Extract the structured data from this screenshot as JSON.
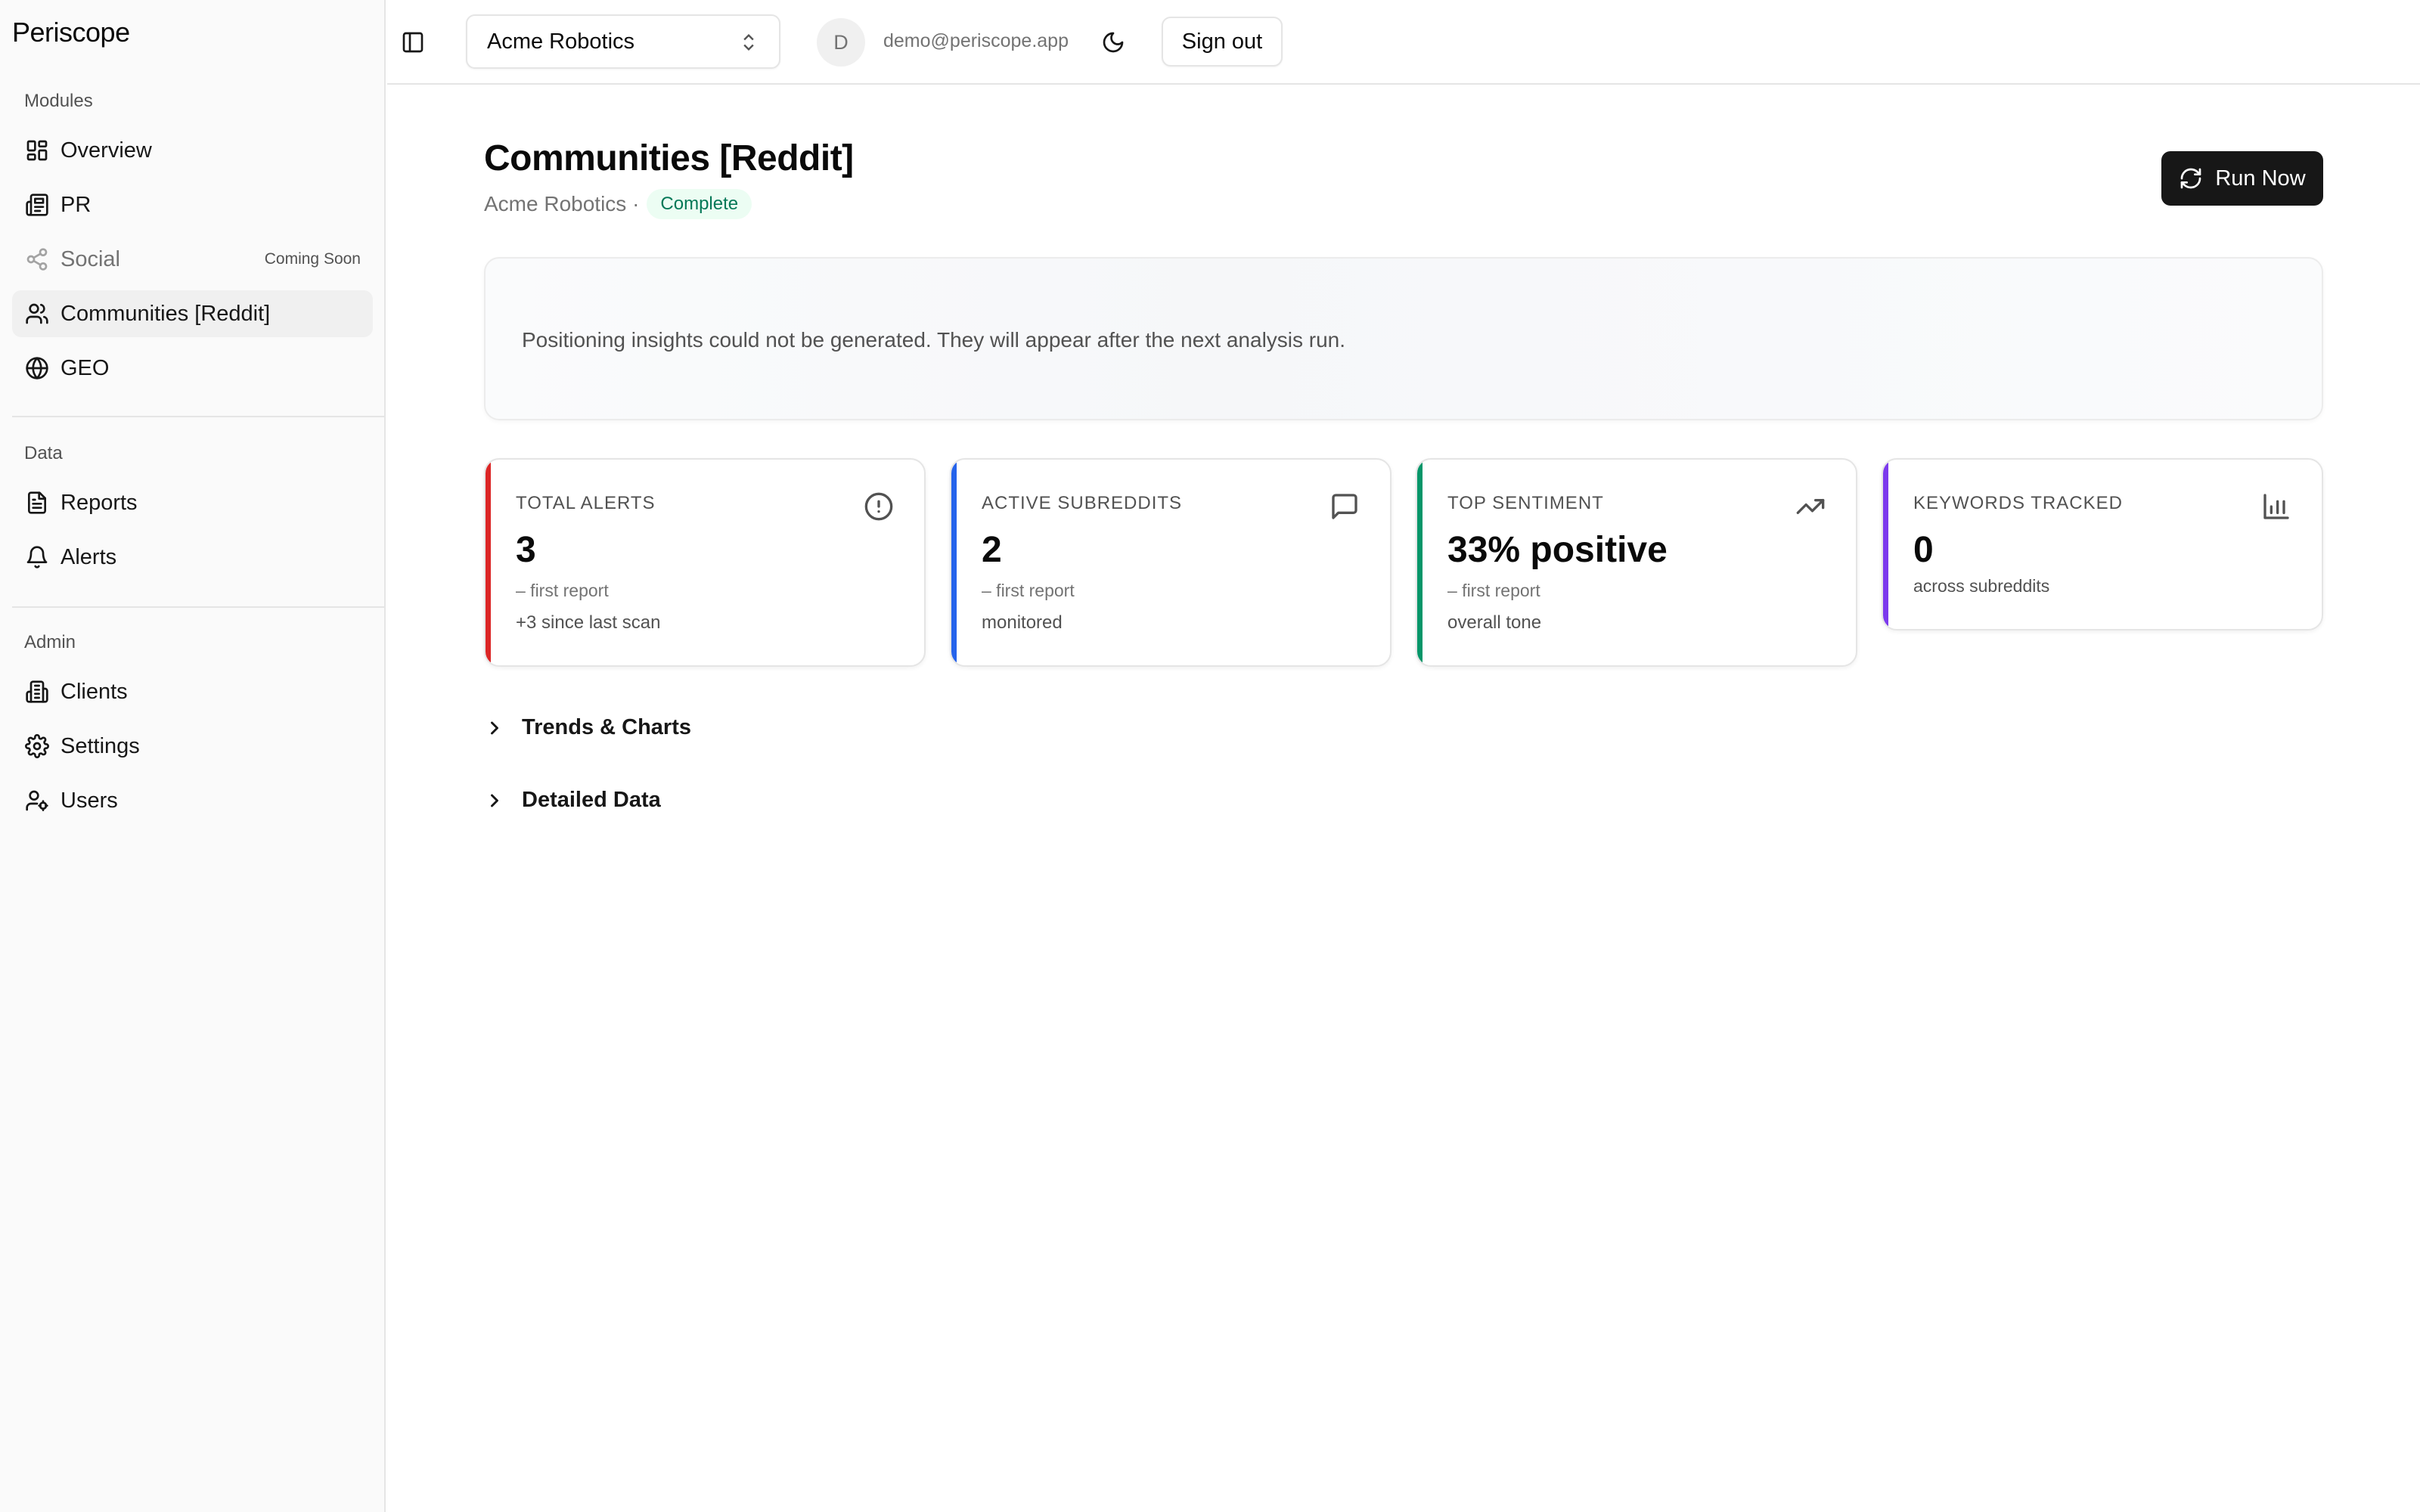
{
  "app": {
    "brand": "Periscope"
  },
  "sidebar": {
    "groups": [
      {
        "label": "Modules",
        "items": [
          {
            "label": "Overview",
            "icon": "dashboard-icon"
          },
          {
            "label": "PR",
            "icon": "newspaper-icon"
          },
          {
            "label": "Social",
            "icon": "share-icon",
            "badge": "Coming Soon",
            "disabled": true
          },
          {
            "label": "Communities [Reddit]",
            "icon": "users-icon",
            "active": true
          },
          {
            "label": "GEO",
            "icon": "globe-icon"
          }
        ]
      },
      {
        "label": "Data",
        "items": [
          {
            "label": "Reports",
            "icon": "file-text-icon"
          },
          {
            "label": "Alerts",
            "icon": "bell-icon"
          }
        ]
      },
      {
        "label": "Admin",
        "items": [
          {
            "label": "Clients",
            "icon": "building-icon"
          },
          {
            "label": "Settings",
            "icon": "gear-icon"
          },
          {
            "label": "Users",
            "icon": "user-cog-icon"
          }
        ]
      }
    ]
  },
  "topbar": {
    "client": "Acme Robotics",
    "avatar_initial": "D",
    "email": "demo@periscope.app",
    "sign_out": "Sign out"
  },
  "main": {
    "title": "Communities [Reddit]",
    "client_name": "Acme Robotics ·",
    "status": "Complete",
    "run_now": "Run Now",
    "insight_message": "Positioning insights could not be generated. They will appear after the next analysis run.",
    "stats": [
      {
        "label": "TOTAL ALERTS",
        "value": "3",
        "line1": "– first report",
        "line2": "+3 since last scan",
        "accent": "#dc2626",
        "icon": "alert-circle-icon"
      },
      {
        "label": "ACTIVE SUBREDDITS",
        "value": "2",
        "line1": "– first report",
        "line2": "monitored",
        "accent": "#2563eb",
        "icon": "message-square-icon"
      },
      {
        "label": "TOP SENTIMENT",
        "value": "33% positive",
        "line1": "– first report",
        "line2": "overall tone",
        "accent": "#059669",
        "icon": "trending-up-icon"
      },
      {
        "label": "KEYWORDS TRACKED",
        "value": "0",
        "line1": "across subreddits",
        "line2": "",
        "accent": "#7c3aed",
        "icon": "bar-chart-icon"
      }
    ],
    "sections": [
      {
        "label": "Trends & Charts"
      },
      {
        "label": "Detailed Data"
      }
    ]
  }
}
